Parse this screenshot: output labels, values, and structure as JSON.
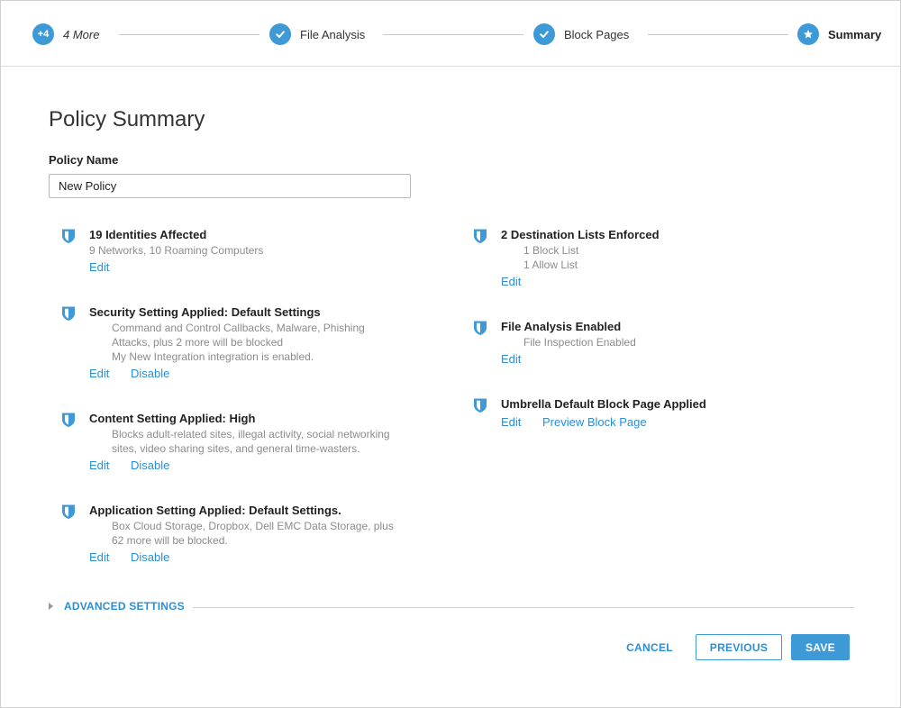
{
  "stepper": {
    "steps": [
      {
        "badge": "+4",
        "label": "4 More"
      },
      {
        "label": "File Analysis"
      },
      {
        "label": "Block Pages"
      },
      {
        "label": "Summary"
      }
    ]
  },
  "page_title": "Policy Summary",
  "policy_name": {
    "label": "Policy Name",
    "value": "New Policy"
  },
  "left_items": [
    {
      "title": "19 Identities Affected",
      "lines": [
        "9 Networks, 10 Roaming Computers"
      ],
      "links": [
        "Edit"
      ]
    },
    {
      "title": "Security Setting Applied: Default Settings",
      "lines": [
        "Command and Control Callbacks, Malware, Phishing",
        "Attacks, plus 2 more will be blocked",
        "My New Integration integration is enabled."
      ],
      "links": [
        "Edit",
        "Disable"
      ]
    },
    {
      "title": "Content Setting Applied: High",
      "lines": [
        "Blocks adult-related sites, illegal activity, social networking",
        "sites, video sharing sites, and general time-wasters."
      ],
      "links": [
        "Edit",
        "Disable"
      ]
    },
    {
      "title": "Application Setting Applied: Default Settings.",
      "lines": [
        "Box Cloud Storage, Dropbox, Dell EMC Data Storage, plus",
        "62 more will be blocked."
      ],
      "links": [
        "Edit",
        "Disable"
      ]
    }
  ],
  "right_items": [
    {
      "title": "2 Destination Lists Enforced",
      "lines": [
        "1 Block List",
        "1 Allow List"
      ],
      "links": [
        "Edit"
      ]
    },
    {
      "title": "File Analysis Enabled",
      "lines": [
        "File Inspection Enabled"
      ],
      "links": [
        "Edit"
      ]
    },
    {
      "title": "Umbrella Default Block Page Applied",
      "lines": [],
      "links": [
        "Edit",
        "Preview Block Page"
      ]
    }
  ],
  "advanced_settings_label": "ADVANCED SETTINGS",
  "buttons": {
    "cancel": "CANCEL",
    "previous": "PREVIOUS",
    "save": "SAVE"
  },
  "icons": {
    "step_done": "checkmark-icon",
    "step_current": "star-icon",
    "item": "shield-icon",
    "advanced": "caret-right-icon"
  },
  "colors": {
    "accent": "#3e9ad6",
    "link": "#2b8ed6",
    "muted_text": "#8c8c8c"
  }
}
